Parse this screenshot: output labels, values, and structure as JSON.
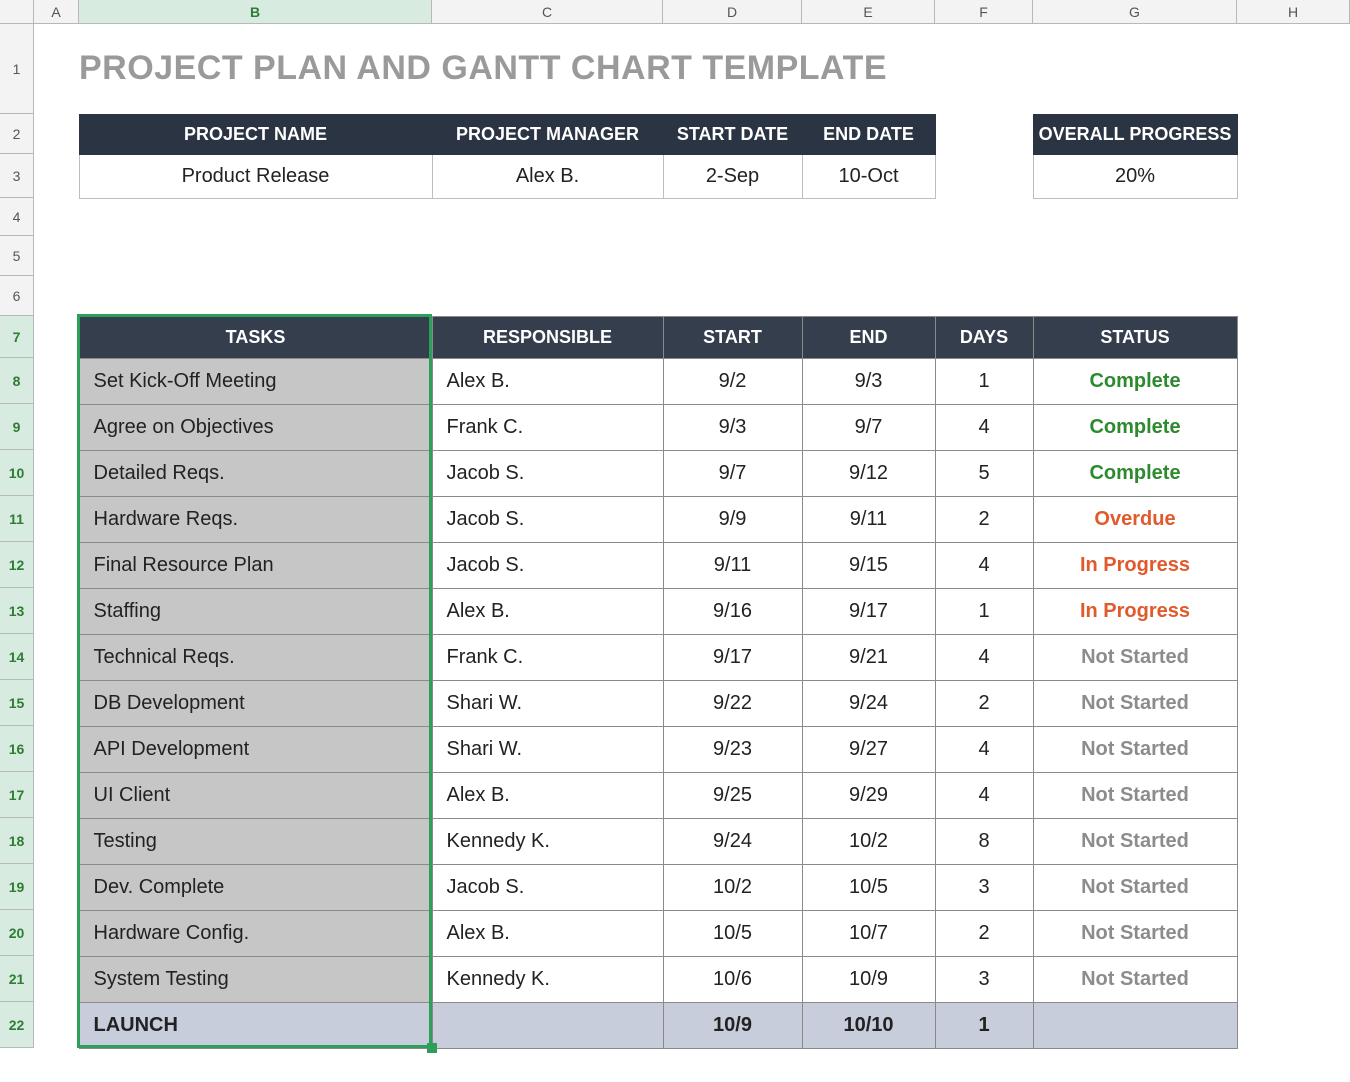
{
  "columns": [
    "A",
    "B",
    "C",
    "D",
    "E",
    "F",
    "G",
    "H"
  ],
  "selected_column": "B",
  "rows": [
    1,
    2,
    3,
    4,
    5,
    6,
    7,
    8,
    9,
    10,
    11,
    12,
    13,
    14,
    15,
    16,
    17,
    18,
    19,
    20,
    21,
    22
  ],
  "selected_rows_start": 7,
  "selected_rows_end": 22,
  "title": "PROJECT PLAN AND GANTT CHART TEMPLATE",
  "summary": {
    "headers": {
      "project_name": "PROJECT NAME",
      "project_manager": "PROJECT MANAGER",
      "start_date": "START DATE",
      "end_date": "END DATE",
      "overall_progress": "OVERALL PROGRESS"
    },
    "values": {
      "project_name": "Product Release",
      "project_manager": "Alex B.",
      "start_date": "2-Sep",
      "end_date": "10-Oct",
      "overall_progress": "20%"
    }
  },
  "tasks_headers": {
    "tasks": "TASKS",
    "responsible": "RESPONSIBLE",
    "start": "START",
    "end": "END",
    "days": "DAYS",
    "status": "STATUS"
  },
  "status_labels": {
    "complete": "Complete",
    "overdue": "Overdue",
    "in_progress": "In Progress",
    "not_started": "Not Started"
  },
  "tasks": [
    {
      "name": "Set Kick-Off Meeting",
      "responsible": "Alex B.",
      "start": "9/2",
      "end": "9/3",
      "days": "1",
      "status": "complete"
    },
    {
      "name": "Agree on Objectives",
      "responsible": "Frank C.",
      "start": "9/3",
      "end": "9/7",
      "days": "4",
      "status": "complete"
    },
    {
      "name": "Detailed Reqs.",
      "responsible": "Jacob S.",
      "start": "9/7",
      "end": "9/12",
      "days": "5",
      "status": "complete"
    },
    {
      "name": "Hardware Reqs.",
      "responsible": "Jacob S.",
      "start": "9/9",
      "end": "9/11",
      "days": "2",
      "status": "overdue"
    },
    {
      "name": "Final Resource Plan",
      "responsible": "Jacob S.",
      "start": "9/11",
      "end": "9/15",
      "days": "4",
      "status": "in_progress"
    },
    {
      "name": "Staffing",
      "responsible": "Alex B.",
      "start": "9/16",
      "end": "9/17",
      "days": "1",
      "status": "in_progress"
    },
    {
      "name": "Technical Reqs.",
      "responsible": "Frank C.",
      "start": "9/17",
      "end": "9/21",
      "days": "4",
      "status": "not_started"
    },
    {
      "name": "DB Development",
      "responsible": "Shari W.",
      "start": "9/22",
      "end": "9/24",
      "days": "2",
      "status": "not_started"
    },
    {
      "name": "API Development",
      "responsible": "Shari W.",
      "start": "9/23",
      "end": "9/27",
      "days": "4",
      "status": "not_started"
    },
    {
      "name": "UI Client",
      "responsible": "Alex B.",
      "start": "9/25",
      "end": "9/29",
      "days": "4",
      "status": "not_started"
    },
    {
      "name": "Testing",
      "responsible": "Kennedy K.",
      "start": "9/24",
      "end": "10/2",
      "days": "8",
      "status": "not_started"
    },
    {
      "name": "Dev. Complete",
      "responsible": "Jacob S.",
      "start": "10/2",
      "end": "10/5",
      "days": "3",
      "status": "not_started"
    },
    {
      "name": "Hardware Config.",
      "responsible": "Alex B.",
      "start": "10/5",
      "end": "10/7",
      "days": "2",
      "status": "not_started"
    },
    {
      "name": "System Testing",
      "responsible": "Kennedy K.",
      "start": "10/6",
      "end": "10/9",
      "days": "3",
      "status": "not_started"
    }
  ],
  "launch": {
    "name": "LAUNCH",
    "responsible": "",
    "start": "10/9",
    "end": "10/10",
    "days": "1",
    "status": ""
  },
  "row_heights": {
    "1": 90,
    "2": 40,
    "3": 44,
    "4": 38,
    "5": 40,
    "6": 40,
    "7": 42,
    "8": 46,
    "9": 46,
    "10": 46,
    "11": 46,
    "12": 46,
    "13": 46,
    "14": 46,
    "15": 46,
    "16": 46,
    "17": 46,
    "18": 46,
    "19": 46,
    "20": 46,
    "21": 46,
    "22": 46
  }
}
